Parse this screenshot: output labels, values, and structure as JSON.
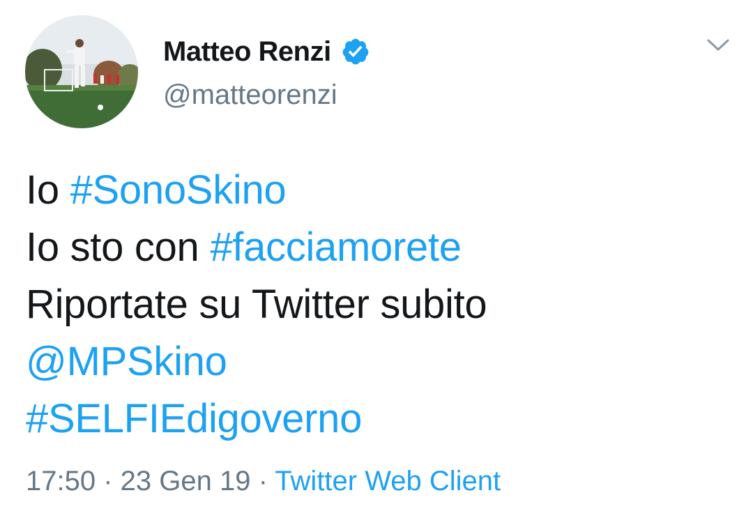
{
  "tweet": {
    "author": {
      "display_name": "Matteo Renzi",
      "handle": "@matteorenzi",
      "verified": true
    },
    "icons": {
      "verified": "verified-badge-icon",
      "caret": "chevron-down-icon"
    },
    "text": {
      "line1": {
        "prefix": "Io ",
        "hashtag": "#SonoSkino"
      },
      "line2": {
        "prefix": "Io sto con ",
        "hashtag": "#facciamorete"
      },
      "line3": "Riportate su Twitter subito",
      "line4": "@MPSkino",
      "line5": "#SELFIEdigoverno"
    },
    "meta": {
      "time": "17:50",
      "separator": " · ",
      "date": "23 Gen 19",
      "source": "Twitter Web Client"
    }
  },
  "colors": {
    "text": "#14171a",
    "secondary": "#657786",
    "link": "#1da1f2",
    "background": "#ffffff"
  }
}
